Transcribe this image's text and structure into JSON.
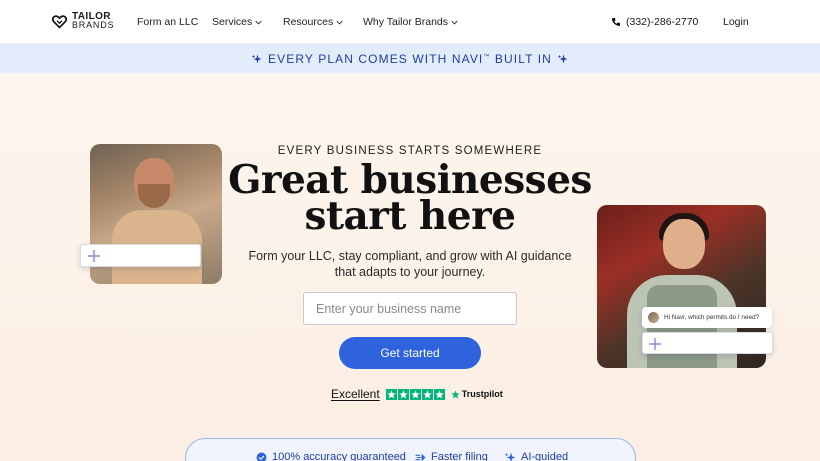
{
  "header": {
    "logo": {
      "line1": "TAILOR",
      "line2": "BRANDS"
    },
    "nav": [
      {
        "label": "Form an LLC",
        "has_dropdown": false
      },
      {
        "label": "Services",
        "has_dropdown": true
      },
      {
        "label": "Resources",
        "has_dropdown": true
      },
      {
        "label": "Why Tailor Brands",
        "has_dropdown": true
      }
    ],
    "phone": "(332)-286-2770",
    "login": "Login"
  },
  "banner": {
    "text": "EVERY PLAN COMES WITH NAVI",
    "trademark": "™",
    "text_suffix": " BUILT IN"
  },
  "hero": {
    "eyebrow": "EVERY BUSINESS STARTS SOMEWHERE",
    "headline_line1": "Great businesses",
    "headline_line2": "start here",
    "subhead": "Form your LLC, stay compliant, and grow with AI guidance that adapts to your journey.",
    "input_placeholder": "Enter your business name",
    "cta_label": "Get started",
    "chat_bubble_text": "Hi Navi, which permits do I need?"
  },
  "trustpilot": {
    "rating_label": "Excellent",
    "stars": 5,
    "brand": "Trustpilot"
  },
  "features": [
    {
      "icon": "check-badge-icon",
      "label": "100% accuracy guaranteed"
    },
    {
      "icon": "speed-icon",
      "label": "Faster filing"
    },
    {
      "icon": "sparkle-icon",
      "label": "AI-guided"
    }
  ],
  "colors": {
    "accent": "#2e63dd",
    "banner_bg": "#e3ecfb",
    "banner_text": "#1f3fa0",
    "trustpilot_green": "#00b67a",
    "hero_bg": "#fdf6ee"
  }
}
